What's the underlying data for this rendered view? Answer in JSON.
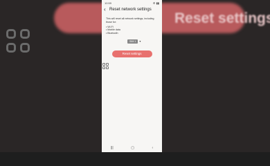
{
  "background": {
    "blurred_label": "Reset settings"
  },
  "status_bar": {
    "time": "10:59",
    "icons": "⚙ ▮▮"
  },
  "header": {
    "back_glyph": "‹",
    "title": "Reset network settings"
  },
  "description": "This will reset all network settings, including those for:",
  "items": [
    "• Wi-Fi",
    "• Mobile data",
    "• Bluetooth"
  ],
  "sim_selector": {
    "value": "SIM 1",
    "caret": "▾"
  },
  "reset_button": {
    "label": "Reset settings",
    "color": "#e8716e"
  },
  "navbar": {
    "recents": "|||",
    "home": "▢",
    "back": "‹"
  }
}
